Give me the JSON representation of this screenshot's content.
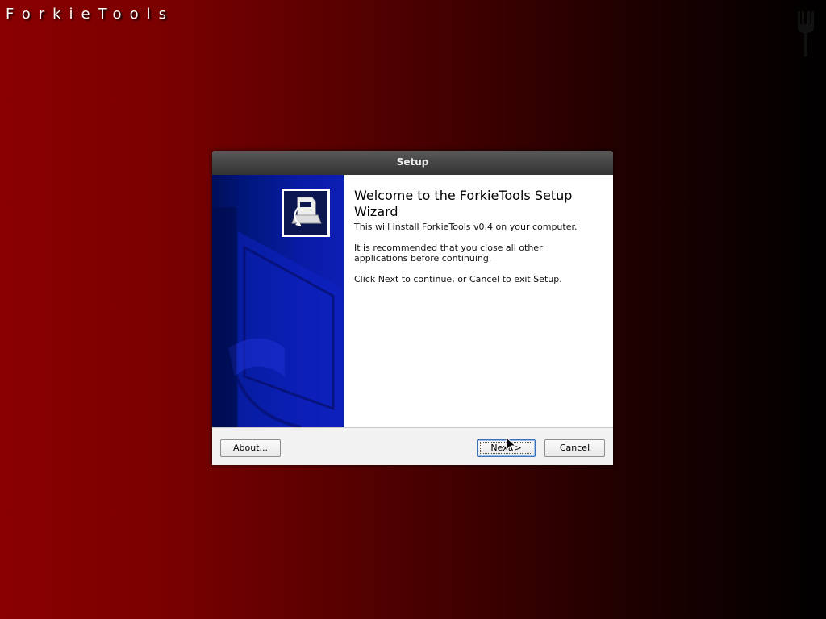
{
  "desktop": {
    "title": "ForkieTools",
    "fork_icon": "fork-icon",
    "background_colors": [
      "#8a0000",
      "#000000"
    ]
  },
  "dialog": {
    "title": "Setup",
    "side_icon": "setup-installer-icon",
    "heading": "Welcome to the ForkieTools Setup Wizard",
    "paragraphs": [
      "This will install ForkieTools v0.4 on your computer.",
      "It is recommended that you close all other applications before continuing.",
      "Click Next to continue, or Cancel to exit Setup."
    ],
    "buttons": {
      "about": "About...",
      "next": "Next >",
      "cancel": "Cancel"
    },
    "side_panel_color": "#0d1fb4"
  },
  "cursor": "mouse-pointer-icon"
}
